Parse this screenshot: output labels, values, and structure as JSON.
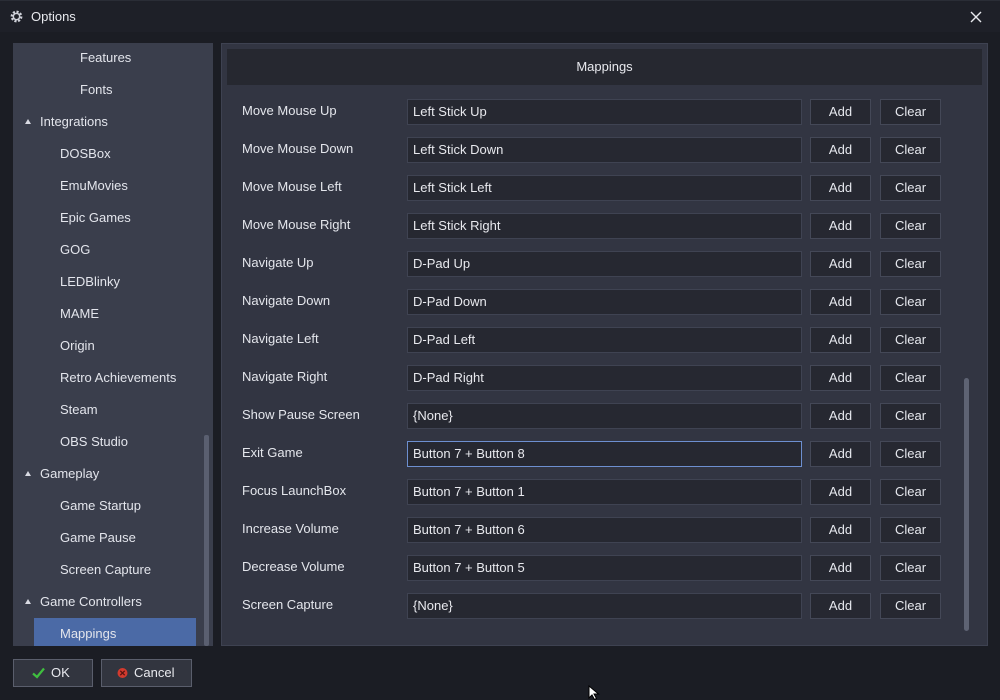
{
  "window": {
    "title": "Options",
    "gear_icon": "gear-icon",
    "close_icon": "close-icon"
  },
  "sidebar": {
    "items": [
      {
        "label": "Features",
        "level": 2
      },
      {
        "label": "Fonts",
        "level": 2
      },
      {
        "label": "Integrations",
        "level": 0,
        "expanded": true
      },
      {
        "label": "DOSBox",
        "level": 1
      },
      {
        "label": "EmuMovies",
        "level": 1
      },
      {
        "label": "Epic Games",
        "level": 1
      },
      {
        "label": "GOG",
        "level": 1
      },
      {
        "label": "LEDBlinky",
        "level": 1
      },
      {
        "label": "MAME",
        "level": 1
      },
      {
        "label": "Origin",
        "level": 1
      },
      {
        "label": "Retro Achievements",
        "level": 1
      },
      {
        "label": "Steam",
        "level": 1
      },
      {
        "label": "OBS Studio",
        "level": 1
      },
      {
        "label": "Gameplay",
        "level": 0,
        "expanded": true
      },
      {
        "label": "Game Startup",
        "level": 1
      },
      {
        "label": "Game Pause",
        "level": 1
      },
      {
        "label": "Screen Capture",
        "level": 1
      },
      {
        "label": "Game Controllers",
        "level": 0,
        "expanded": true
      },
      {
        "label": "Mappings",
        "level": 1,
        "selected": true
      }
    ]
  },
  "main": {
    "header": "Mappings",
    "add_label": "Add",
    "clear_label": "Clear",
    "rows": [
      {
        "label": "Move Mouse Up",
        "value": "Left Stick Up"
      },
      {
        "label": "Move Mouse Down",
        "value": "Left Stick Down"
      },
      {
        "label": "Move Mouse Left",
        "value": "Left Stick Left"
      },
      {
        "label": "Move Mouse Right",
        "value": "Left Stick Right"
      },
      {
        "label": "Navigate Up",
        "value": "D-Pad Up"
      },
      {
        "label": "Navigate Down",
        "value": "D-Pad Down"
      },
      {
        "label": "Navigate Left",
        "value": "D-Pad Left"
      },
      {
        "label": "Navigate Right",
        "value": "D-Pad Right"
      },
      {
        "label": "Show Pause Screen",
        "value": "{None}"
      },
      {
        "label": "Exit Game",
        "value": "Button 7 + Button 8",
        "focused": true
      },
      {
        "label": "Focus LaunchBox",
        "value": "Button 7 + Button 1"
      },
      {
        "label": "Increase Volume",
        "value": "Button 7 + Button 6"
      },
      {
        "label": "Decrease Volume",
        "value": "Button 7 + Button 5"
      },
      {
        "label": "Screen Capture",
        "value": "{None}"
      }
    ]
  },
  "footer": {
    "ok_label": "OK",
    "ok_icon": "checkmark-icon",
    "cancel_label": "Cancel",
    "cancel_icon": "cancel-icon"
  },
  "colors": {
    "selection": "#4b6aa6",
    "focus_border": "#6d8fd0",
    "ok_check": "#3fbf3f",
    "cancel_red": "#d23a2e"
  }
}
